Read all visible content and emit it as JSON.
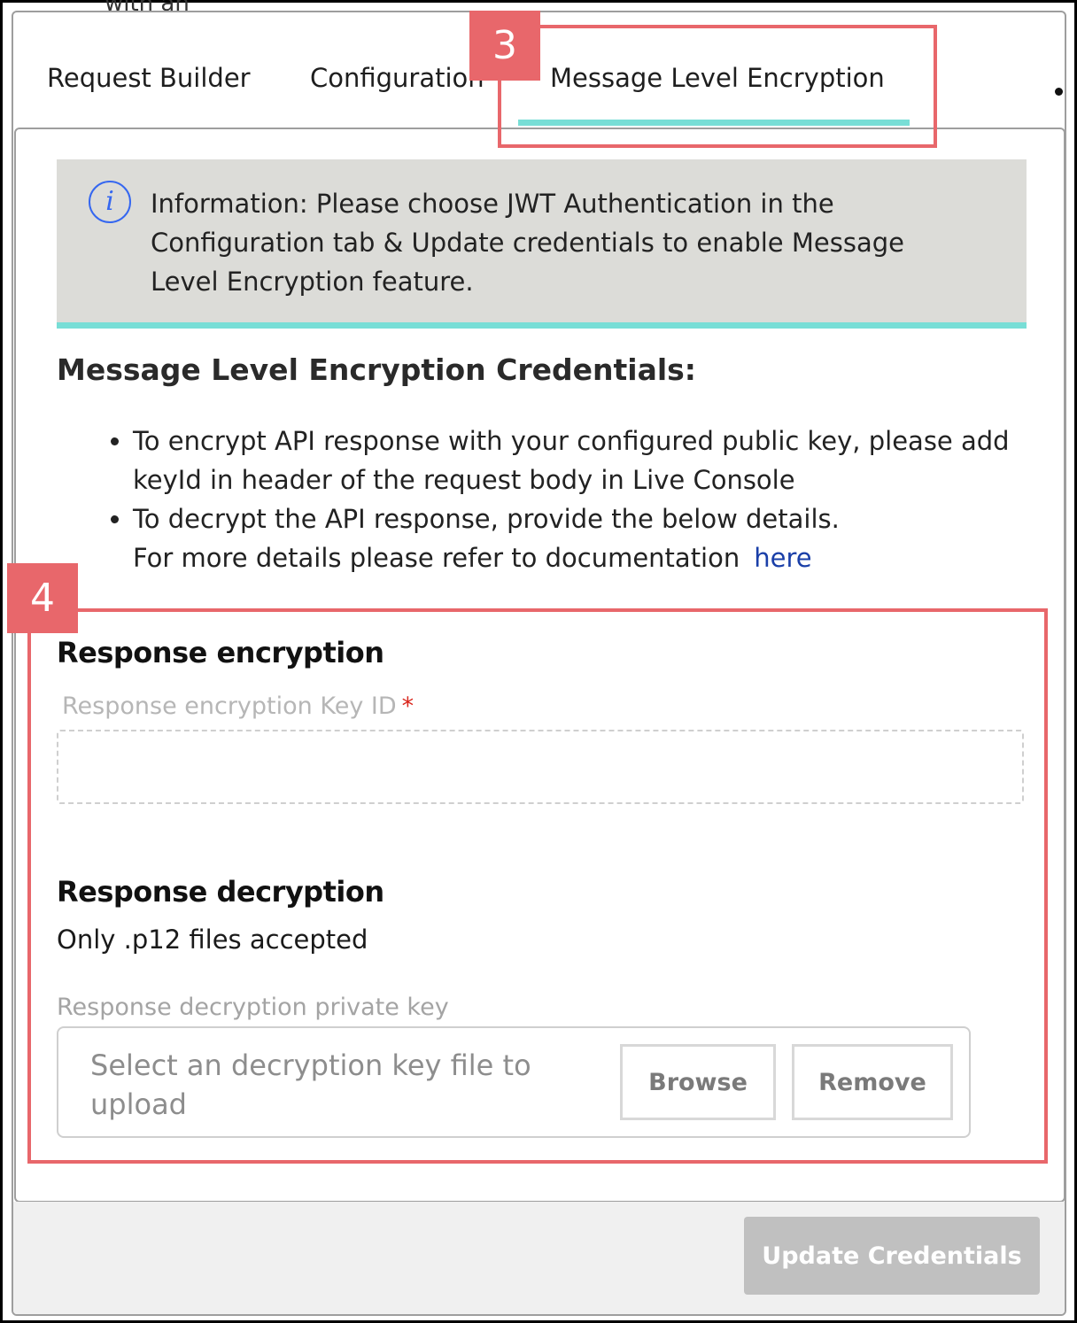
{
  "header": {
    "cut_off_text": "with an"
  },
  "tabs": [
    {
      "label": "Request Builder"
    },
    {
      "label": "Configuration"
    },
    {
      "label": "Message Level Encryption",
      "active": true
    }
  ],
  "info": {
    "icon": "info-icon",
    "icon_glyph": "i",
    "text": "Information: Please choose JWT Authentication in the Configuration tab & Update credentials to enable Message Level Encryption feature."
  },
  "credentials": {
    "title": "Message Level Encryption Credentials:",
    "bullet1": "To encrypt API response with your configured public key, please add keyId in header of the request body in Live Console",
    "bullet2_line1": "To decrypt the API response, provide the below details.",
    "bullet2_line2": "For more details please refer to documentation",
    "link": "here"
  },
  "response_encryption": {
    "title": "Response encryption",
    "key_label": "Response encryption Key ID",
    "required_mark": "*",
    "key_value": ""
  },
  "response_decryption": {
    "title": "Response decryption",
    "note": "Only .p12 files accepted",
    "field_label": "Response decryption private key",
    "placeholder": "Select an decryption key file to upload",
    "browse_label": "Browse",
    "remove_label": "Remove"
  },
  "footer": {
    "update_label": "Update Credentials"
  },
  "callouts": {
    "tab_marker": "3",
    "form_marker": "4"
  },
  "colors": {
    "accent": "#78ded6",
    "callout": "#e8676b",
    "info_bg": "#dcdcd8",
    "link": "#1a3fa8",
    "info_icon": "#3567f0",
    "required": "#d9261c",
    "disabled_button": "#c0c0c0"
  }
}
